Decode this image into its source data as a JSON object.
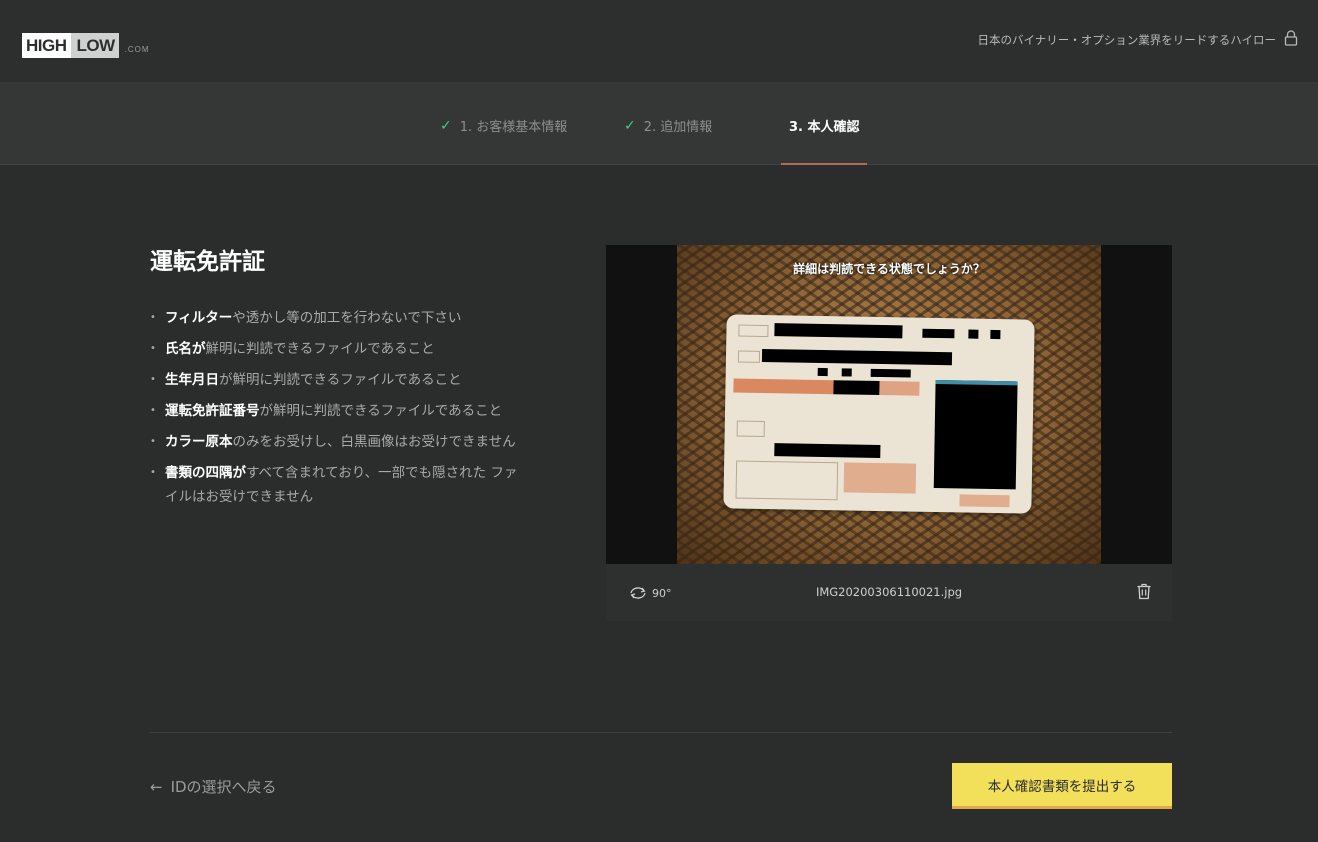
{
  "header": {
    "logo": {
      "high": "HIGH",
      "low": "LOW",
      "com": ".COM"
    },
    "tagline": "日本のバイナリー・オプション業界をリードするハイロー"
  },
  "steps": [
    {
      "label": "1. お客様基本情報",
      "status": "done"
    },
    {
      "label": "2. 追加情報",
      "status": "done"
    },
    {
      "label": "3. 本人確認",
      "status": "active"
    }
  ],
  "main": {
    "title": "運転免許証",
    "requirements": [
      {
        "bold": "フィルター",
        "rest": "や透かし等の加工を行わないで下さい"
      },
      {
        "bold": "氏名が",
        "rest": "鮮明に判読できるファイルであること"
      },
      {
        "bold": "生年月日",
        "rest": "が鮮明に判読できるファイルであること"
      },
      {
        "bold": "運転免許証番号",
        "rest": "が鮮明に判読できるファイルであること"
      },
      {
        "bold": "カラー原本",
        "rest": "のみをお受けし、白黒画像はお受けできません"
      },
      {
        "bold": "書類の四隅が",
        "rest": "すべて含まれており、一部でも隠された ファイルはお受けできません"
      }
    ]
  },
  "preview": {
    "question": "詳細は判読できる状態でしょうか？",
    "rotate_label": "90°",
    "filename": "IMG20200306110021.jpg"
  },
  "footer": {
    "back_label": "IDの選択へ戻る",
    "submit_label": "本人確認書類を提出する"
  },
  "colors": {
    "accent": "#f2df5a",
    "check": "#2fd28c",
    "underline": "#b06a55"
  }
}
